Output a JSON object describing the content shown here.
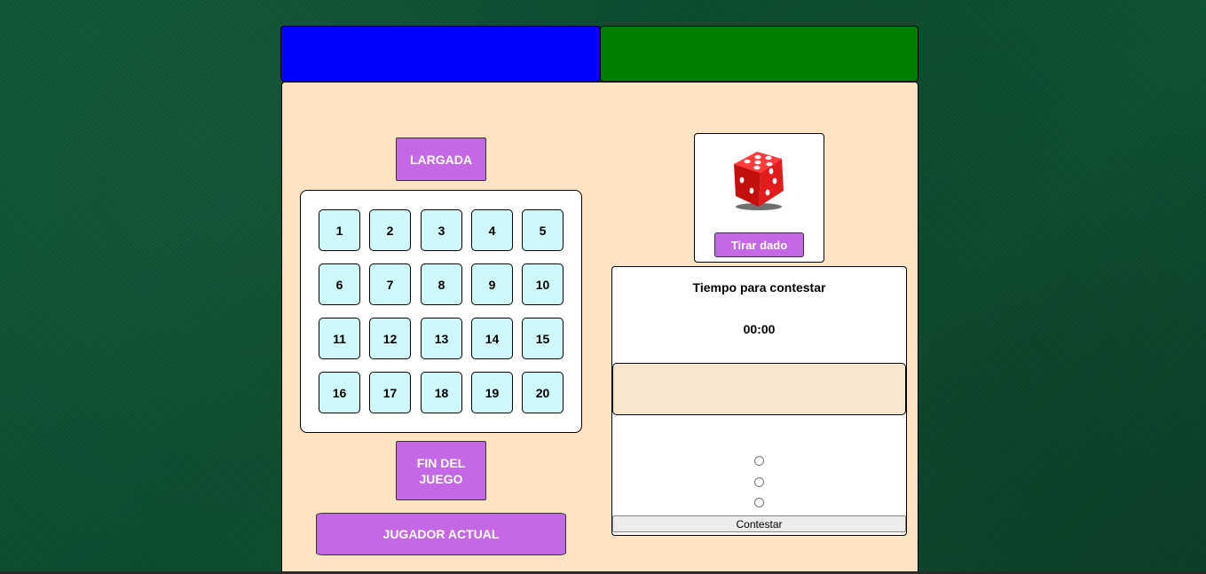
{
  "colors": {
    "player1": "#0000ff",
    "player2": "#008000",
    "board_bg": "#ffe4c4",
    "button": "#c468e6",
    "cell": "#cff8fb",
    "question_box": "#f7e7cf"
  },
  "buttons": {
    "largada": "LARGADA",
    "fin_del_juego": "FIN DEL JUEGO",
    "jugador_actual": "JUGADOR ACTUAL",
    "tirar_dado": "Tirar dado",
    "contestar": "Contestar"
  },
  "cells": [
    "1",
    "2",
    "3",
    "4",
    "5",
    "6",
    "7",
    "8",
    "9",
    "10",
    "11",
    "12",
    "13",
    "14",
    "15",
    "16",
    "17",
    "18",
    "19",
    "20"
  ],
  "question": {
    "title": "Tiempo para contestar",
    "timer": "00:00",
    "text": "",
    "options": [
      "",
      "",
      ""
    ]
  },
  "dice": {
    "icon": "red-dice-icon"
  }
}
